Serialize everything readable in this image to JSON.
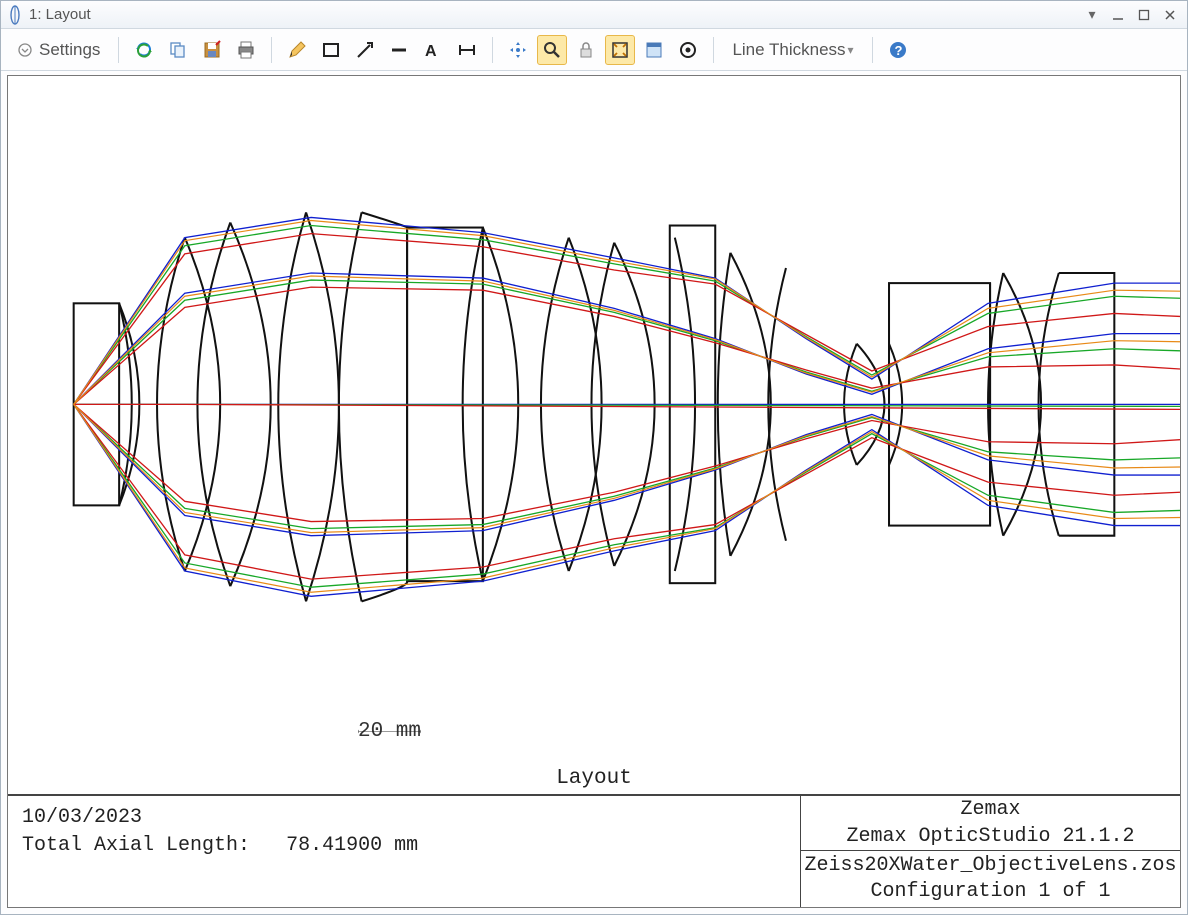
{
  "window": {
    "title": "1: Layout"
  },
  "toolbar": {
    "settings_label": "Settings",
    "line_thickness_label": "Line Thickness"
  },
  "scalebar": {
    "label": "20 mm"
  },
  "footer": {
    "title": "Layout",
    "date": "10/03/2023",
    "axial_length_label": "Total Axial Length:",
    "axial_length_value": "78.41900 mm",
    "vendor": "Zemax",
    "product": "Zemax OpticStudio 21.1.2",
    "file": "Zeiss20XWater_ObjectiveLens.zos",
    "config": "Configuration 1 of 1"
  },
  "chart_data": {
    "type": "diagram",
    "description": "2D optical layout / ray-trace cross-section of a multi-element microscope objective lens",
    "total_axial_length_mm": 78.419,
    "scale_bar_mm": 20,
    "optical_axis": "horizontal, centered vertically in plot",
    "ray_bundles": [
      {
        "color": "blue",
        "hex": "#1020d0"
      },
      {
        "color": "green",
        "hex": "#10a020"
      },
      {
        "color": "red",
        "hex": "#d01010"
      },
      {
        "color": "orange",
        "hex": "#e08010"
      }
    ],
    "lens_groups_approx": 9,
    "notes": "Rays originate from a point at the left (object plane), fan through a series of doublet/triplet lens groups drawn in black outline, converge toward the right through a field-lens group, and exit collimated at the right edge. Element outlines drawn black; rays drawn in four colors representing different field heights/wavelengths."
  }
}
